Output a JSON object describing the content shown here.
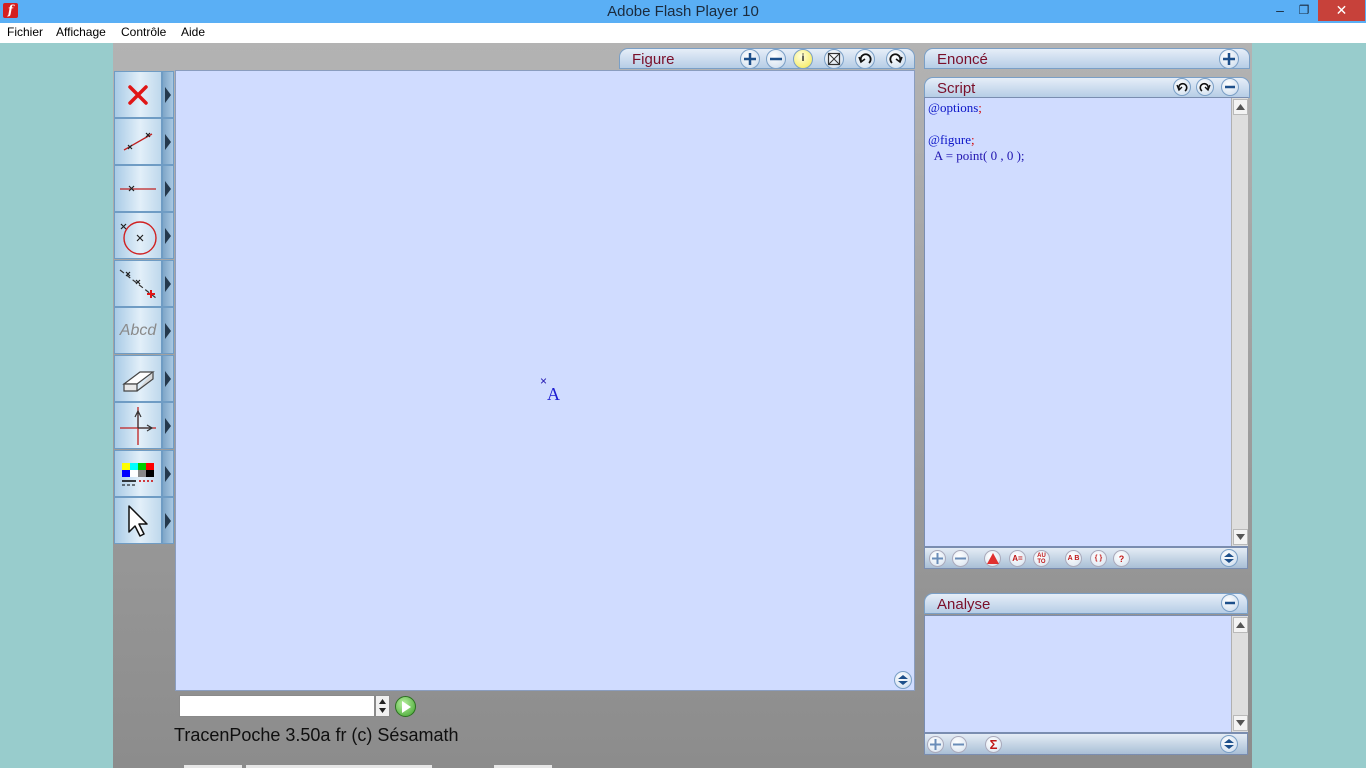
{
  "window": {
    "title": "Adobe Flash Player 10",
    "minimize_label": "–",
    "maximize_label": "❐",
    "close_label": "✕"
  },
  "menu": {
    "items": [
      "Fichier",
      "Affichage",
      "Contrôle",
      "Aide"
    ]
  },
  "toolbar": {
    "tools": [
      {
        "name": "delete-tool",
        "icon": "red-x-icon"
      },
      {
        "name": "segment-tool",
        "icon": "segment-icon"
      },
      {
        "name": "line-tool",
        "icon": "line-icon"
      },
      {
        "name": "circle-tool",
        "icon": "circle-icon"
      },
      {
        "name": "point-on-line-tool",
        "icon": "points-on-line-icon"
      },
      {
        "name": "text-tool",
        "icon": "text-icon",
        "label": "Abcd"
      },
      {
        "name": "eraser-tool",
        "icon": "eraser-icon"
      },
      {
        "name": "axes-tool",
        "icon": "axes-icon"
      },
      {
        "name": "style-tool",
        "icon": "color-palette-icon"
      },
      {
        "name": "pointer-tool",
        "icon": "pointer-icon"
      }
    ]
  },
  "figure": {
    "tab_label": "Figure",
    "point_marker": "×",
    "point_label": "A",
    "info_label": "i"
  },
  "enonce": {
    "tab_label": "Enoncé"
  },
  "script": {
    "tab_label": "Script",
    "lines": {
      "options_kw": "@options",
      "options_rest": ";",
      "figure_kw": "@figure",
      "figure_rest": ";",
      "point_def": "  A = point( 0 , 0 );"
    },
    "bottom_buttons": [
      "add",
      "remove",
      "triangle",
      "A=",
      "AUTO",
      "AB",
      "{}",
      "?"
    ],
    "auto_label": "AU TO",
    "aeq_label": "A=",
    "ab_label": "A B",
    "braces_label": "{ }",
    "help_label": "?"
  },
  "analyse": {
    "tab_label": "Analyse",
    "sigma_label": "Σ"
  },
  "command": {
    "input_value": ""
  },
  "footer": {
    "version_text": "TracenPoche 3.50a fr (c) Sésamath"
  },
  "colors": {
    "titlebar": "#5aaff5",
    "canvas": "#d0dcff",
    "panel_tab_text": "#7a0f2a",
    "desktop": "#98cccc"
  }
}
